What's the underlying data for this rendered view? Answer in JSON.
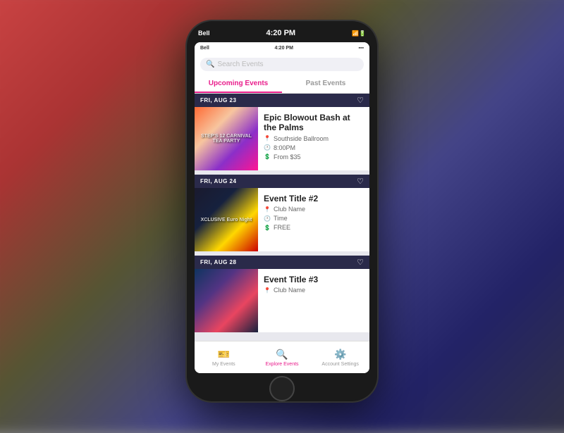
{
  "background": {},
  "statusBar": {
    "carrier": "Bell",
    "time": "4:20 PM",
    "batteryText": "🔋"
  },
  "searchBar": {
    "placeholder": "Search Events"
  },
  "tabs": [
    {
      "id": "upcoming",
      "label": "Upcoming Events",
      "active": true
    },
    {
      "id": "past",
      "label": "Past Events",
      "active": false
    }
  ],
  "events": [
    {
      "id": 1,
      "date": "FRI, AUG 23",
      "title": "Epic Blowout Bash at the Palms",
      "venue": "Southside Ballroom",
      "time": "8:00PM",
      "price": "From $35",
      "imgLabel": "STEP'S 12\nCARNIVAL\nTEA PARTY"
    },
    {
      "id": 2,
      "date": "FRI, AUG 24",
      "title": "Event Title #2",
      "venue": "Club Name",
      "time": "Time",
      "price": "FREE",
      "imgLabel": "XCLUSIVE\nEuro Night"
    },
    {
      "id": 3,
      "date": "FRI, AUG 28",
      "title": "Event Title #3",
      "venue": "Club Name",
      "time": "",
      "price": "",
      "imgLabel": ""
    }
  ],
  "bottomNav": [
    {
      "id": "my-events",
      "label": "My Events",
      "icon": "🎫",
      "active": false
    },
    {
      "id": "explore-events",
      "label": "Explore Events",
      "icon": "🔍",
      "active": true
    },
    {
      "id": "account-settings",
      "label": "Account Settings",
      "icon": "⚙️",
      "active": false
    }
  ]
}
